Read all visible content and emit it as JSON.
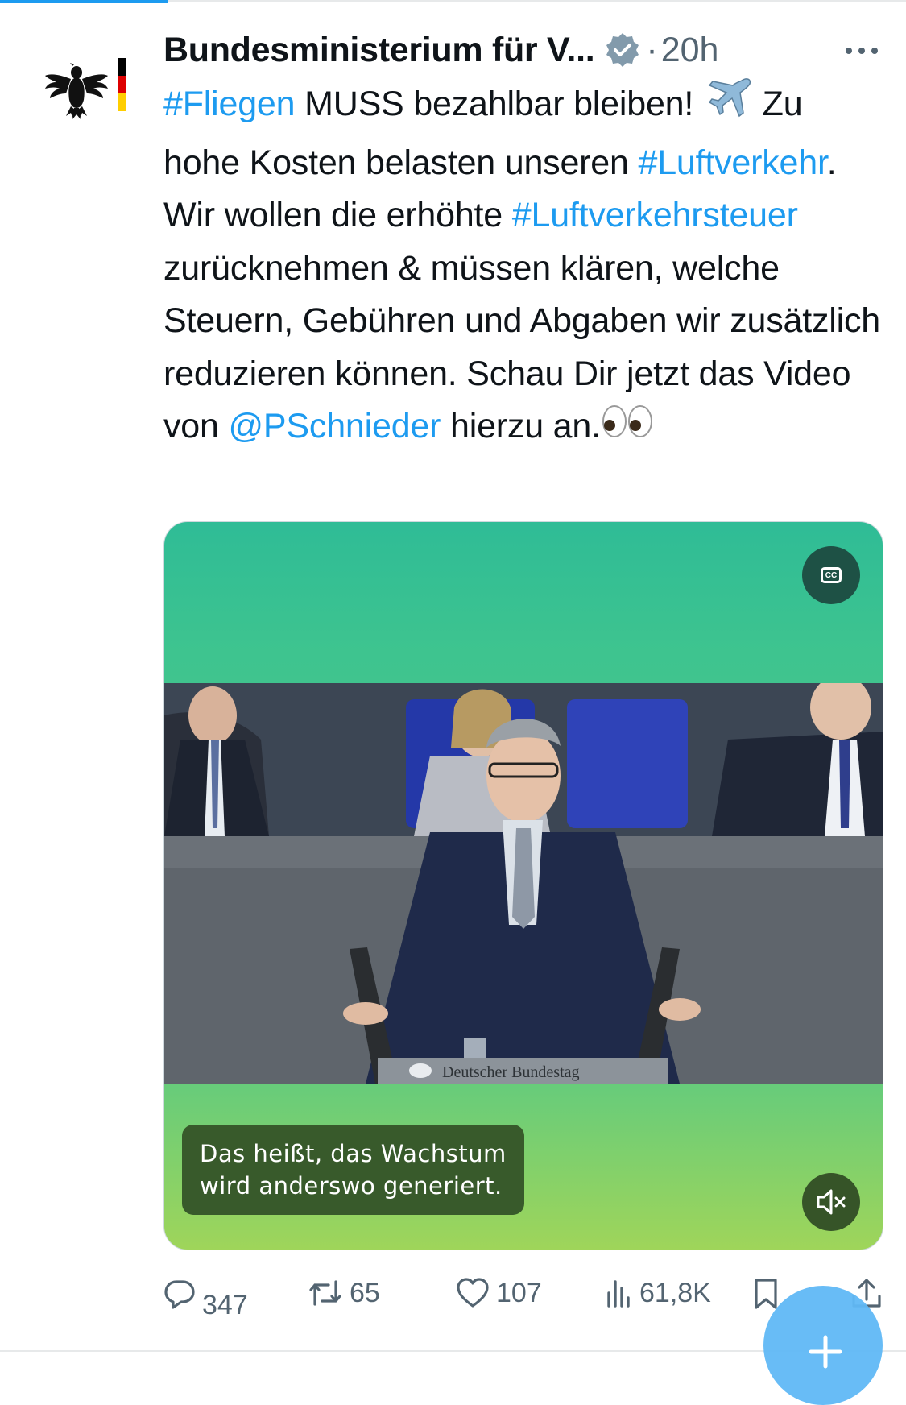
{
  "tweet": {
    "author_name": "Bundesministerium für V...",
    "dot": "·",
    "time": "20h",
    "text": {
      "hashtag_fliegen": "#Fliegen",
      "part1": " MUSS bezahlbar bleiben! ",
      "part2": " Zu hohe Kosten belasten unseren ",
      "hashtag_luftverkehr": "#Luftverkehr",
      "part3": ". Wir wollen die erhöhte ",
      "hashtag_luftverkehrsteuer": "#Luftverkehrsteuer",
      "part4": " zurücknehmen & müssen klären, welche Steuern, Gebühren und Abgaben wir zusätzlich reduzieren können. Schau Dir jetzt das Video von ",
      "mention": "@PSchnieder",
      "part5": " hierzu an."
    },
    "icons": {
      "verified": "verified-badge-icon",
      "airplane": "airplane-emoji-icon",
      "eyes": "eyes-emoji-icon",
      "more": "more-icon"
    }
  },
  "video": {
    "caption_line1": "Das heißt, das Wachstum",
    "caption_line2": "wird anderswo generiert.",
    "cc_label": "CC",
    "podium_label": "Deutscher Bundestag"
  },
  "actions": {
    "replies": "347",
    "retweets": "65",
    "likes": "107",
    "views": "61,8K"
  },
  "colors": {
    "link": "#1d9bf0",
    "text": "#0f1419",
    "secondary": "#536471",
    "fab": "#60b8f5"
  }
}
